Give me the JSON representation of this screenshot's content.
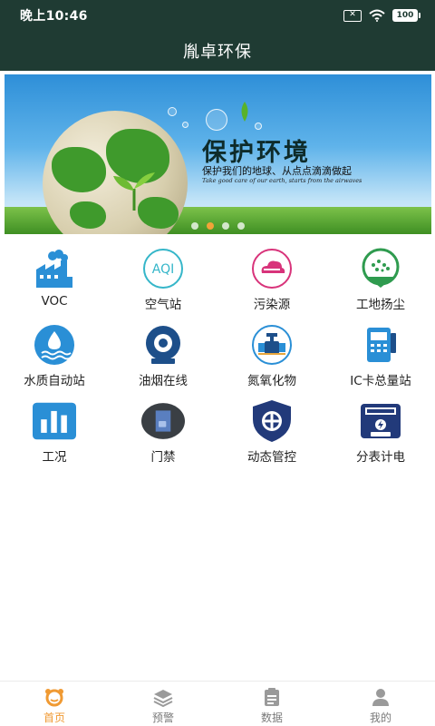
{
  "status": {
    "time": "晚上10:46",
    "sim_icon": "sim-off-icon",
    "wifi_icon": "wifi-icon",
    "battery": "100"
  },
  "header": {
    "title": "胤卓环保"
  },
  "banner": {
    "title": "保护环境",
    "subtitle": "保护我们的地球、从点点滴滴做起",
    "caption": "Take good care of our earth, starts from the airwaves",
    "page_count": 4,
    "active_index": 1
  },
  "modules": [
    {
      "label": "VOC",
      "icon": "factory-icon",
      "color": "#2a8fd6"
    },
    {
      "label": "空气站",
      "icon": "aqi-icon",
      "color": "#35b6c9"
    },
    {
      "label": "污染源",
      "icon": "pollution-cloud-icon",
      "color": "#d8337a"
    },
    {
      "label": "工地扬尘",
      "icon": "dust-icon",
      "color": "#2f9b4f"
    },
    {
      "label": "水质自动站",
      "icon": "water-drop-icon",
      "color": "#2a8fd6"
    },
    {
      "label": "油烟在线",
      "icon": "chimney-icon",
      "color": "#1d4f8a"
    },
    {
      "label": "氮氧化物",
      "icon": "pipeline-icon",
      "color": "#2a8fd6"
    },
    {
      "label": "IC卡总量站",
      "icon": "card-reader-icon",
      "color": "#2a8fd6"
    },
    {
      "label": "工况",
      "icon": "bar-chart-icon",
      "color": "#2a8fd6"
    },
    {
      "label": "门禁",
      "icon": "door-access-icon",
      "color": "#3a3f44"
    },
    {
      "label": "动态管控",
      "icon": "shield-icon",
      "color": "#223a7a"
    },
    {
      "label": "分表计电",
      "icon": "meter-icon",
      "color": "#223a7a"
    }
  ],
  "tabs": [
    {
      "label": "首页",
      "icon": "home-icon",
      "active": true
    },
    {
      "label": "预警",
      "icon": "layers-icon",
      "active": false
    },
    {
      "label": "数据",
      "icon": "clipboard-icon",
      "active": false
    },
    {
      "label": "我的",
      "icon": "user-icon",
      "active": false
    }
  ],
  "colors": {
    "header_bg": "#1f3b33",
    "accent": "#f09a33",
    "tab_inactive": "#7a7a7a"
  }
}
